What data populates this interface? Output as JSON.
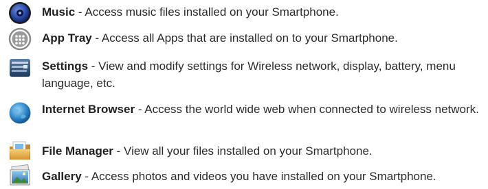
{
  "items": [
    {
      "icon": "music-icon",
      "name": "Music",
      "separator": " - ",
      "description": "Access music files installed on your Smartphone."
    },
    {
      "icon": "app-tray-icon",
      "name": "App Tray",
      "separator": " - ",
      "description": "Access all Apps that are installed on to your Smartphone."
    },
    {
      "icon": "settings-icon",
      "name": "Settings",
      "separator": " - ",
      "description": "View and modify settings for Wireless network, display, battery, menu language, etc."
    },
    {
      "icon": "internet-browser-icon",
      "name": "Internet Browser",
      "separator": " - ",
      "description": "Access the world wide web when connected to wireless network."
    },
    {
      "icon": "file-manager-icon",
      "name": "File Manager",
      "separator": " - ",
      "description": "View all your files installed on your Smartphone."
    },
    {
      "icon": "gallery-icon",
      "name": "Gallery",
      "separator": " - ",
      "description": "Access photos and videos you have installed on your Smartphone."
    }
  ]
}
